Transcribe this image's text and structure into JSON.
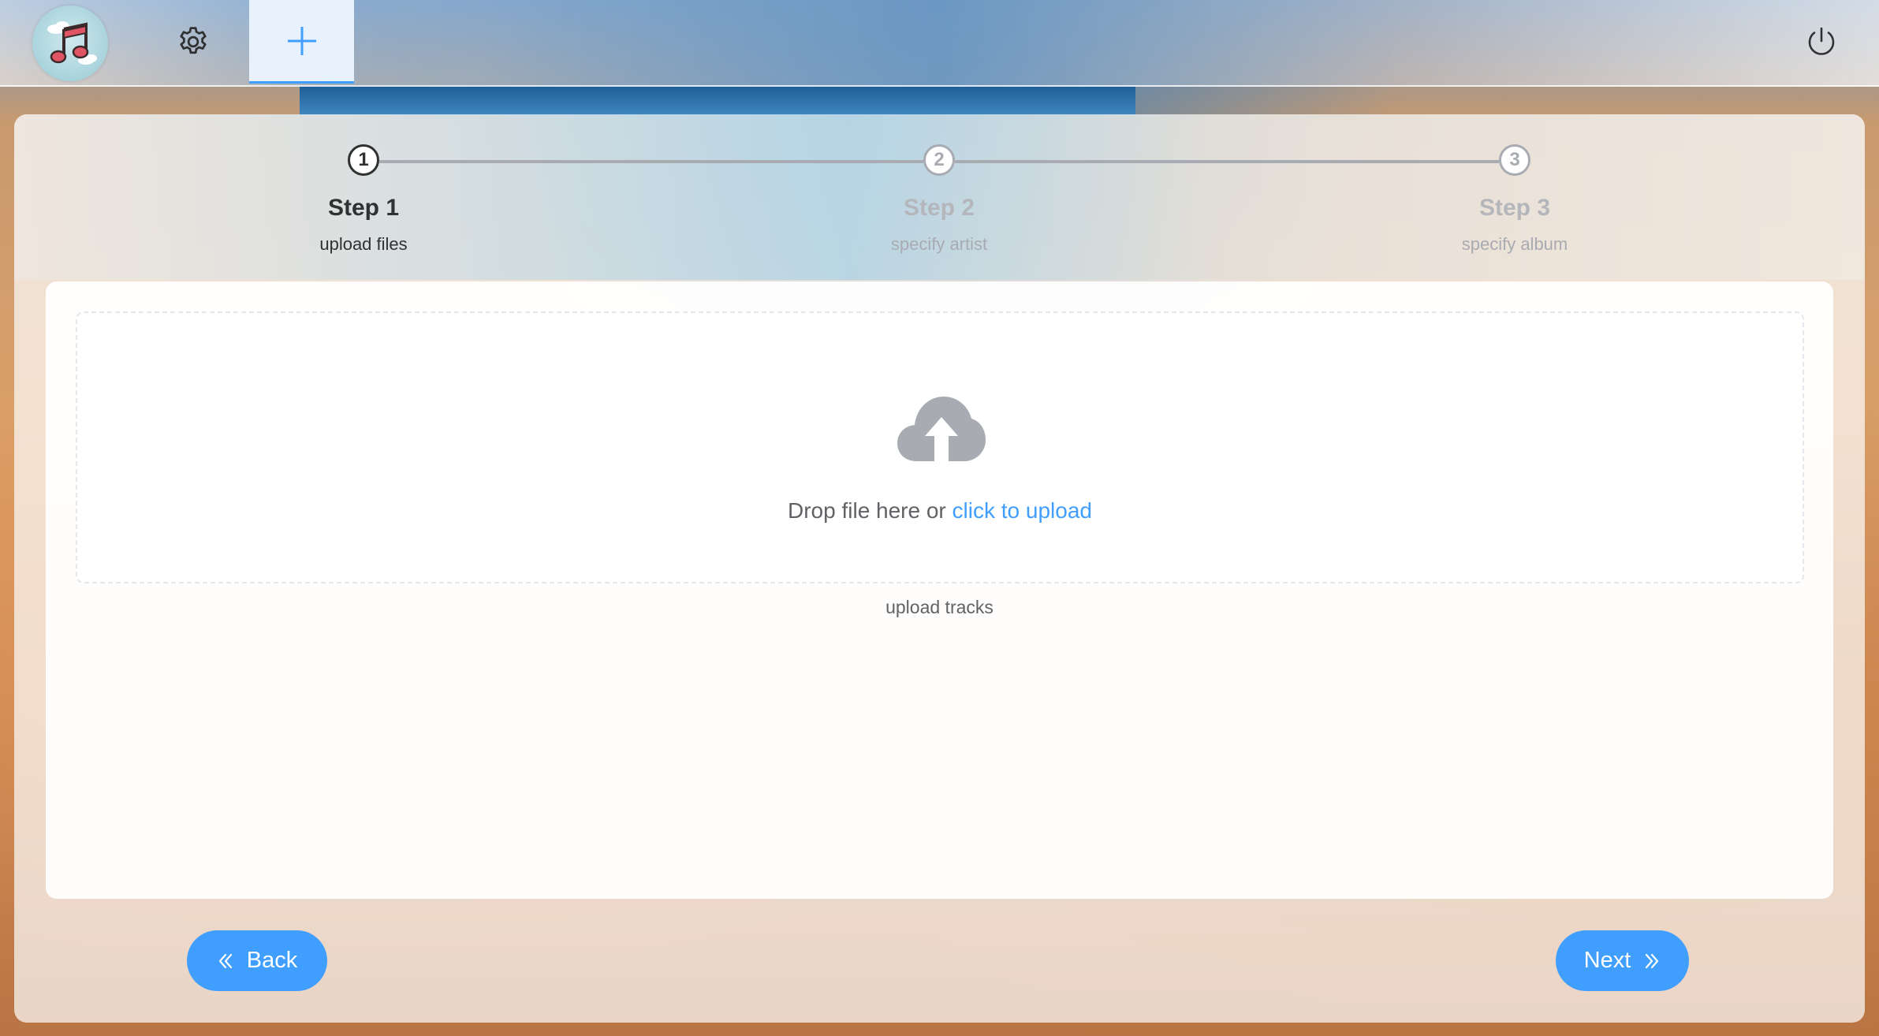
{
  "header": {
    "logo_icon": "music-note-logo",
    "settings_icon": "gear-icon",
    "add_icon": "plus-icon",
    "power_icon": "power-icon"
  },
  "steps": [
    {
      "number": "1",
      "title": "Step 1",
      "description": "upload files",
      "active": true
    },
    {
      "number": "2",
      "title": "Step 2",
      "description": "specify artist",
      "active": false
    },
    {
      "number": "3",
      "title": "Step 3",
      "description": "specify album",
      "active": false
    }
  ],
  "upload": {
    "icon": "cloud-upload-icon",
    "drop_text": "Drop file here or ",
    "link_text": "click to upload",
    "tip": "upload tracks"
  },
  "footer": {
    "back_label": "Back",
    "next_label": "Next",
    "back_icon": "double-chevron-left-icon",
    "next_icon": "double-chevron-right-icon"
  },
  "colors": {
    "accent": "#409eff",
    "text_primary": "#303133",
    "text_muted": "#a8abb2"
  }
}
